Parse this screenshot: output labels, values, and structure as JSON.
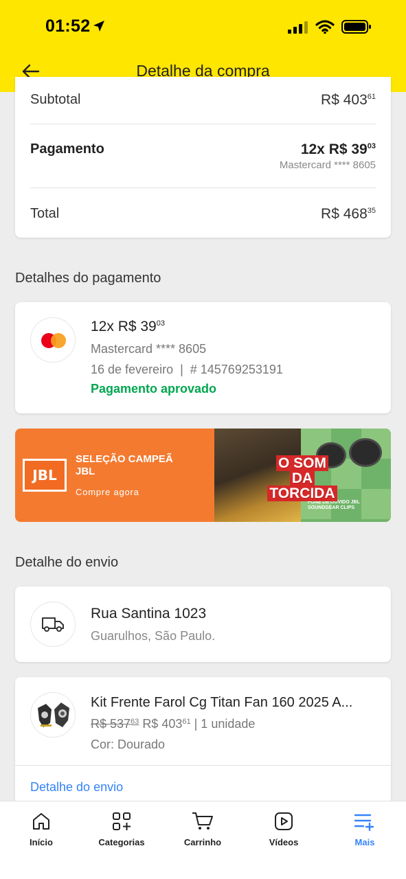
{
  "status_bar": {
    "time": "01:52"
  },
  "header": {
    "title": "Detalhe da compra"
  },
  "summary": {
    "subtotal_label": "Subtotal",
    "subtotal_main": "R$ 403",
    "subtotal_cents": "61",
    "payment_label": "Pagamento",
    "payment_main": "12x R$ 39",
    "payment_cents": "03",
    "payment_card": "Mastercard **** 8605",
    "total_label": "Total",
    "total_main": "R$ 468",
    "total_cents": "35"
  },
  "payment_details": {
    "section_title": "Detalhes do pagamento",
    "amount_main": "12x R$ 39",
    "amount_cents": "03",
    "card": "Mastercard **** 8605",
    "date_and_id": "16 de fevereiro  |  # 145769253191",
    "status": "Pagamento aprovado",
    "status_color": "#00a650"
  },
  "banner": {
    "logo_text": "JBL",
    "title": "SELEÇÃO CAMPEÃ JBL",
    "cta": "Compre agora",
    "headline_1": "O SOM",
    "headline_2": "DA",
    "headline_3": "TORCIDA",
    "small_text": "FONE DE OUVIDO JBL SOUNDGEAR CLIPS"
  },
  "shipping": {
    "section_title": "Detalhe do envio",
    "street": "Rua Santina 1023",
    "city": "Guarulhos, São Paulo.",
    "icon": "truck-icon"
  },
  "item": {
    "title": "Kit Frente Farol Cg Titan Fan 160 2025 A...",
    "old_price_main": "R$ 537",
    "old_price_cents": "63",
    "price_main": "R$ 403",
    "price_cents": "61",
    "quantity": "| 1 unidade",
    "color": "Cor: Dourado",
    "link": "Detalhe do envio"
  },
  "tabbar": {
    "items": [
      {
        "label": "Início",
        "icon": "home-icon"
      },
      {
        "label": "Categorias",
        "icon": "categories-icon"
      },
      {
        "label": "Carrinho",
        "icon": "cart-icon"
      },
      {
        "label": "Vídeos",
        "icon": "video-icon"
      },
      {
        "label": "Mais",
        "icon": "more-icon",
        "active": true
      }
    ]
  },
  "colors": {
    "header": "#ffe600",
    "accent": "#3483fa",
    "success": "#00a650",
    "banner": "#f47a30"
  }
}
